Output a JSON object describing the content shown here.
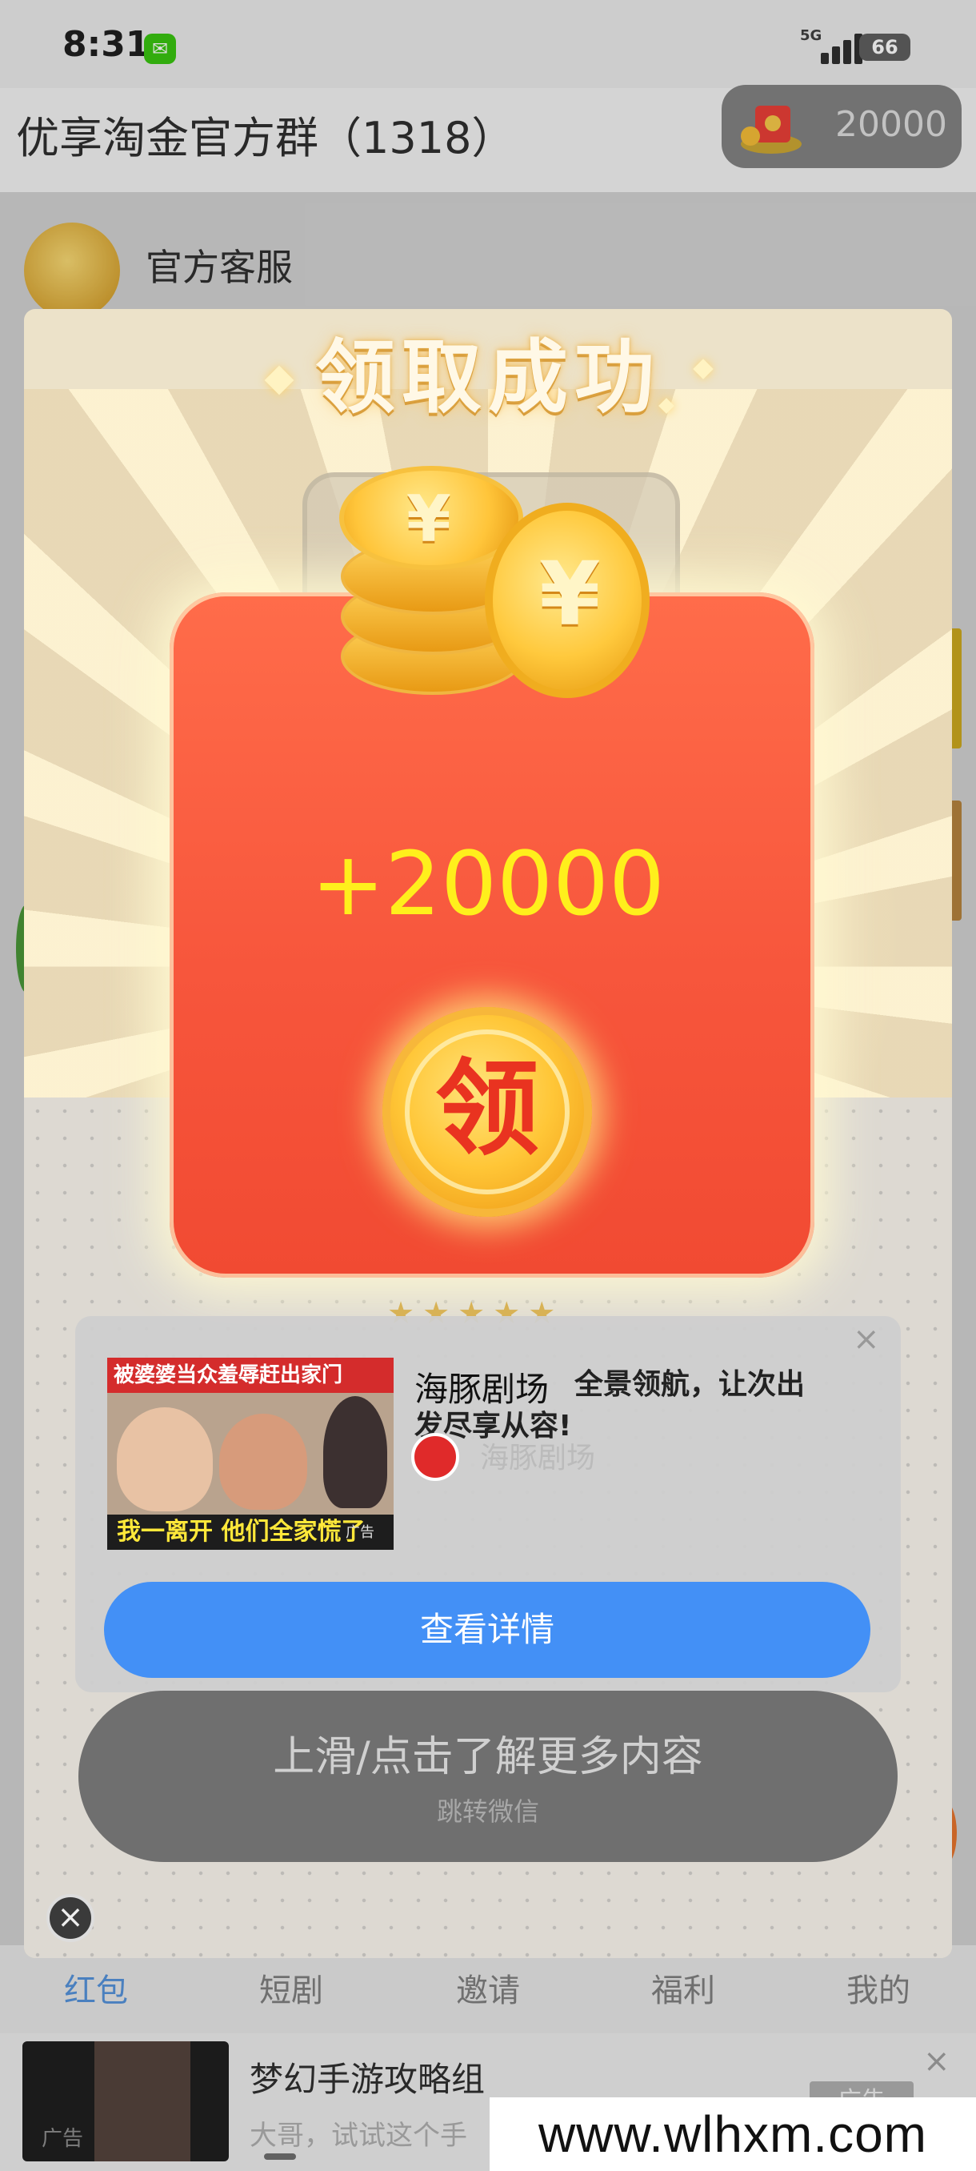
{
  "status_bar": {
    "time": "8:31",
    "network": "5G",
    "battery": "66",
    "app_notification_icon": "wechat-icon"
  },
  "header": {
    "group_title": "优享淘金官方群（1318）",
    "coin_balance": "20000",
    "coin_icon": "red-envelope-icon"
  },
  "chat": {
    "first_sender": "官方客服"
  },
  "reward_modal": {
    "title": "领取成功",
    "amount": "+20000",
    "claim_button": "领",
    "stars": "★★★★★",
    "accent_color": "#f7563c",
    "amount_color": "#ffef1c"
  },
  "ad_card": {
    "thumbnail_top_text": "被婆婆当众羞辱赶出家门",
    "thumbnail_bottom_text": "我一离开 他们全家慌了",
    "thumbnail_ad_mark": "广告",
    "brand": "海豚剧场",
    "description": "全景领航，让次出发尽享从容!",
    "logo_name": "海豚剧场",
    "cta": "查看详情",
    "close": "×"
  },
  "swipe_prompt": {
    "main": "上滑/点击了解更多内容",
    "sub": "跳转微信"
  },
  "modal_close": "×",
  "tabs": [
    {
      "label": "红包",
      "active": true
    },
    {
      "label": "短剧",
      "active": false
    },
    {
      "label": "邀请",
      "active": false
    },
    {
      "label": "福利",
      "active": false
    },
    {
      "label": "我的",
      "active": false
    }
  ],
  "bottom_ad": {
    "title": "梦幻手游攻略组",
    "subtitle": "大哥，试试这个手",
    "thumb_tag": "广告",
    "badge": "广告",
    "close": "×"
  },
  "watermark": "www.wlhxm.com"
}
